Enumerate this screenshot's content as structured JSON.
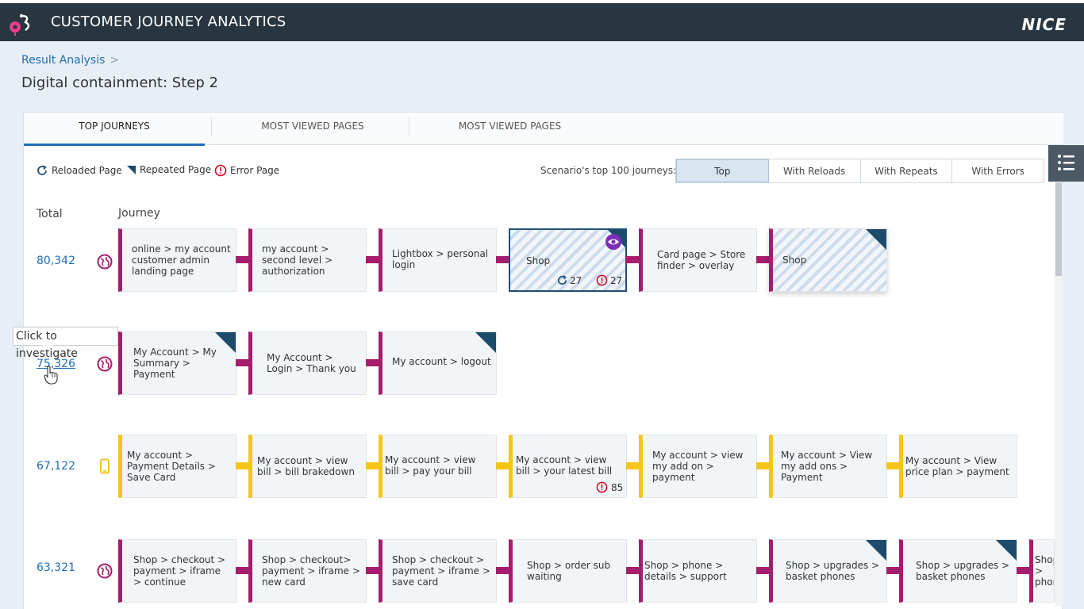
{
  "header": {
    "app_title": "CUSTOMER JOURNEY ANALYTICS",
    "brand": "NICE"
  },
  "breadcrumb": {
    "label": "Result Analysis",
    "separator": ">"
  },
  "page_title": "Digital containment: Step 2",
  "tabs": [
    {
      "label": "TOP JOURNEYS",
      "active": true
    },
    {
      "label": "MOST VIEWED PAGES",
      "active": false
    },
    {
      "label": "MOST VIEWED PAGES",
      "active": false
    }
  ],
  "legend": {
    "reloaded": "Reloaded Page",
    "repeated": "Repeated Page",
    "error": "Error Page"
  },
  "scenario": {
    "label": "Scenario's top 100 journeys:",
    "buttons": [
      "Top",
      "With Reloads",
      "With Repeats",
      "With Errors"
    ],
    "active": "Top"
  },
  "columns": {
    "total": "Total",
    "journey": "Journey"
  },
  "tooltip": "Click to investigate",
  "rows": [
    {
      "total": "80,342",
      "channel": "web",
      "cards": [
        {
          "text": "online > my account customer admin landing page"
        },
        {
          "text": "my account > second level > authorization"
        },
        {
          "text": "Lightbox > personal login"
        },
        {
          "text": "Shop",
          "reloads": "27",
          "errors": "27"
        },
        {
          "text": "Card page > Store finder > overlay"
        },
        {
          "text": "Shop"
        }
      ]
    },
    {
      "total": "75,326",
      "channel": "web",
      "cards": [
        {
          "text": "My Account > My Summary > Payment"
        },
        {
          "text": "My Account > Login > Thank you"
        },
        {
          "text": "My account > logout"
        }
      ]
    },
    {
      "total": "67,122",
      "channel": "mobile",
      "cards": [
        {
          "text": "My account > Payment Details > Save Card"
        },
        {
          "text": "My account > view bill > bill brakedown"
        },
        {
          "text": "My account > view bill > pay your bill"
        },
        {
          "text": "My account > view bill > your latest bill",
          "errors": "85"
        },
        {
          "text": "My account > view my add on > payment"
        },
        {
          "text": "My account > View my add ons > Payment"
        },
        {
          "text": "My account > View price plan > payment"
        }
      ]
    },
    {
      "total": "63,321",
      "channel": "web",
      "cards": [
        {
          "text": "Shop > checkout > payment > iframe > continue"
        },
        {
          "text": "Shop > checkout> payment > iframe > new card"
        },
        {
          "text": "Shop > checkout > payment > iframe > save card"
        },
        {
          "text": "Shop > order sub waiting"
        },
        {
          "text": "Shop > phone > details > support"
        },
        {
          "text": "Shop > upgrades > basket phones"
        },
        {
          "text": "Shop > upgrades > basket phones"
        },
        {
          "text": "Shop > phon"
        }
      ]
    }
  ],
  "colors": {
    "magenta": "#a61d6d",
    "yellow": "#f5c518",
    "link": "#1e6fb5",
    "header_bg": "#283641"
  }
}
